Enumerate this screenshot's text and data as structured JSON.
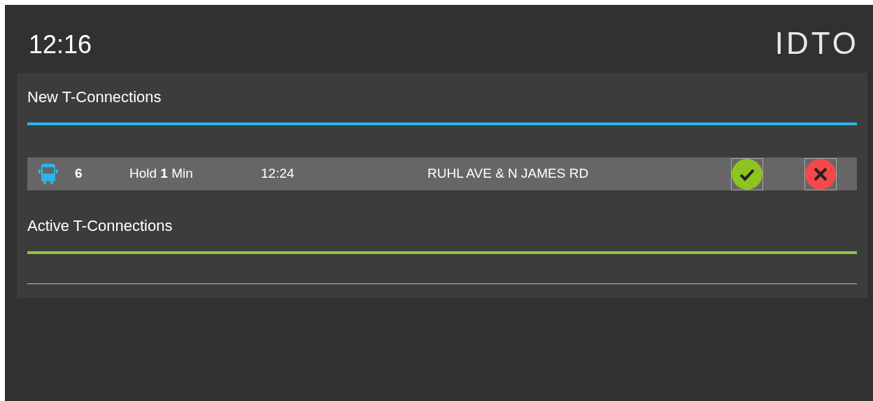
{
  "header": {
    "time": "12:16",
    "logo": "IDTO"
  },
  "sections": [
    {
      "title": "New T-Connections",
      "kind": "new",
      "rows": [
        {
          "route": "6",
          "hold": "Hold **1** Min",
          "time": "12:24",
          "stop": "RUHL AVE & N JAMES RD"
        }
      ]
    },
    {
      "title": "Active T-Connections",
      "kind": "active"
    }
  ]
}
